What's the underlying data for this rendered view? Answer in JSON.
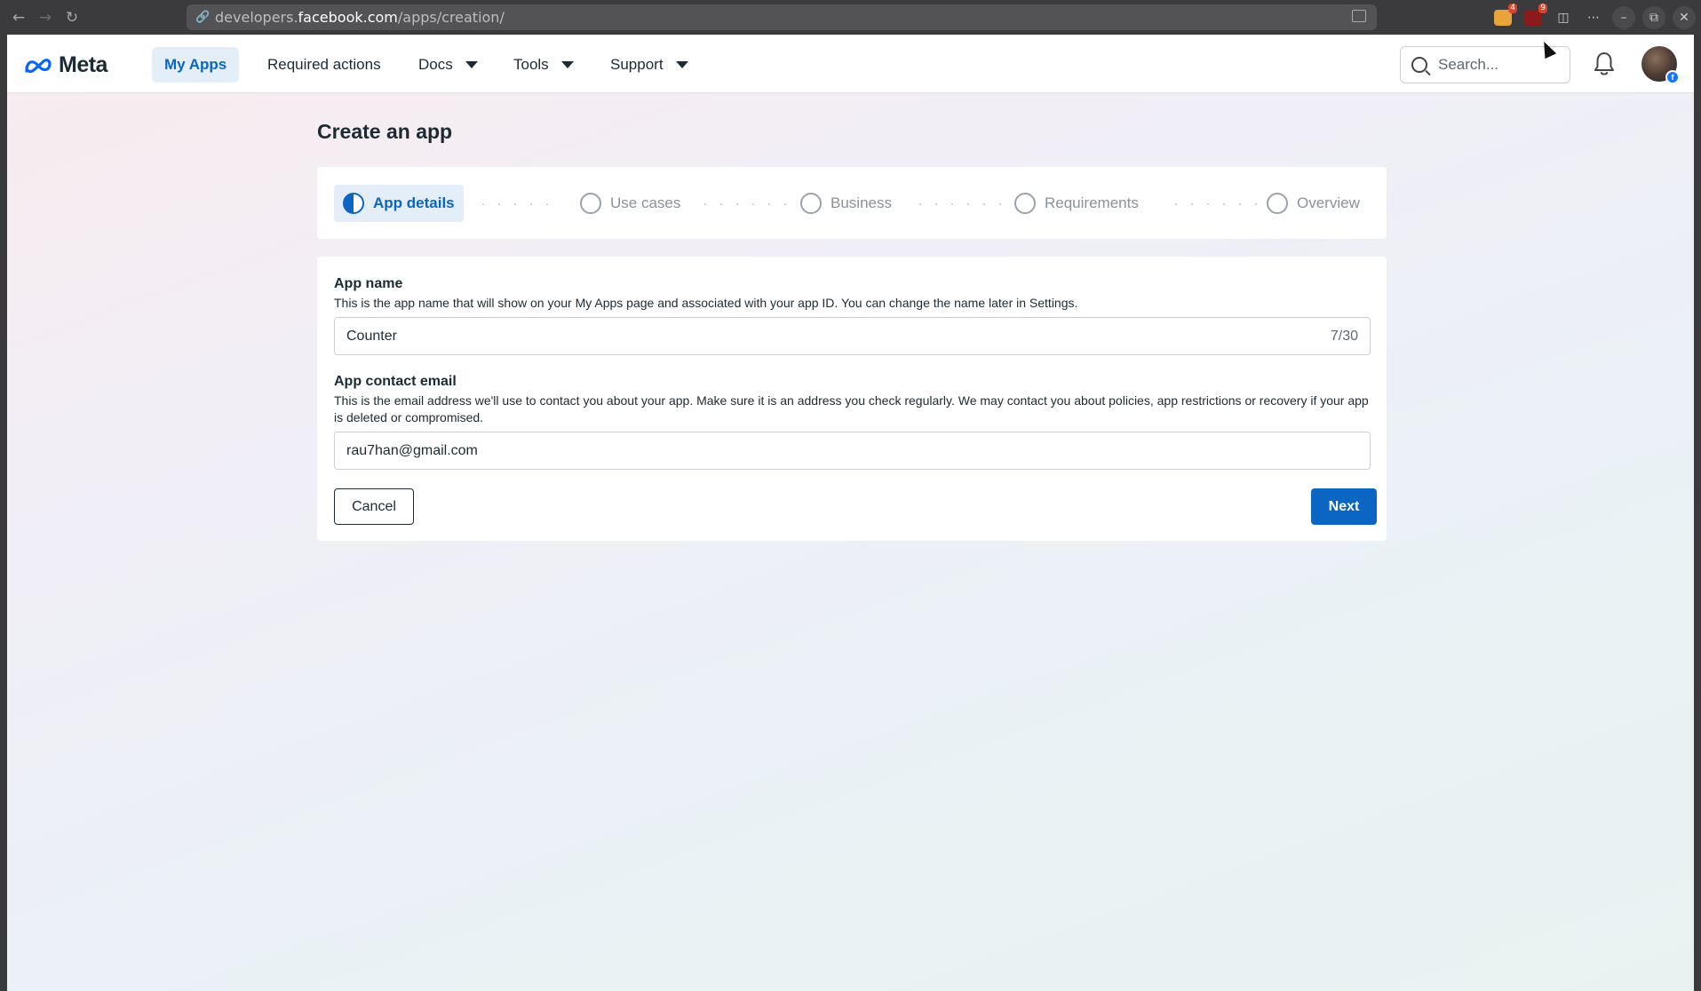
{
  "browser": {
    "url_prefix": "developers.",
    "url_host": "facebook.com",
    "url_path": "/apps/creation/",
    "extensions": [
      {
        "name": "extension-1",
        "badge": "4",
        "color": "#e8a43a"
      },
      {
        "name": "ublock",
        "badge": "9",
        "color": "#8b1a1a"
      }
    ]
  },
  "nav": {
    "logo": "Meta",
    "items": [
      {
        "label": "My Apps",
        "active": true
      },
      {
        "label": "Required actions"
      },
      {
        "label": "Docs",
        "dropdown": true
      },
      {
        "label": "Tools",
        "dropdown": true
      },
      {
        "label": "Support",
        "dropdown": true
      }
    ],
    "search_placeholder": "Search..."
  },
  "page_title": "Create an app",
  "steps": [
    {
      "label": "App details",
      "active": true
    },
    {
      "label": "Use cases"
    },
    {
      "label": "Business"
    },
    {
      "label": "Requirements"
    },
    {
      "label": "Overview"
    }
  ],
  "form": {
    "app_name_label": "App name",
    "app_name_desc": "This is the app name that will show on your My Apps page and associated with your app ID. You can change the name later in Settings.",
    "app_name_value": "Counter",
    "app_name_count": "7/30",
    "email_label": "App contact email",
    "email_desc": "This is the email address we'll use to contact you about your app. Make sure it is an address you check regularly. We may contact you about policies, app restrictions or recovery if your app is deleted or compromised.",
    "email_value": "rau7han@gmail.com",
    "cancel_label": "Cancel",
    "next_label": "Next"
  },
  "colors": {
    "accent": "#0a66c2",
    "active_bg": "#e4eef8",
    "text": "#1c2b33"
  }
}
